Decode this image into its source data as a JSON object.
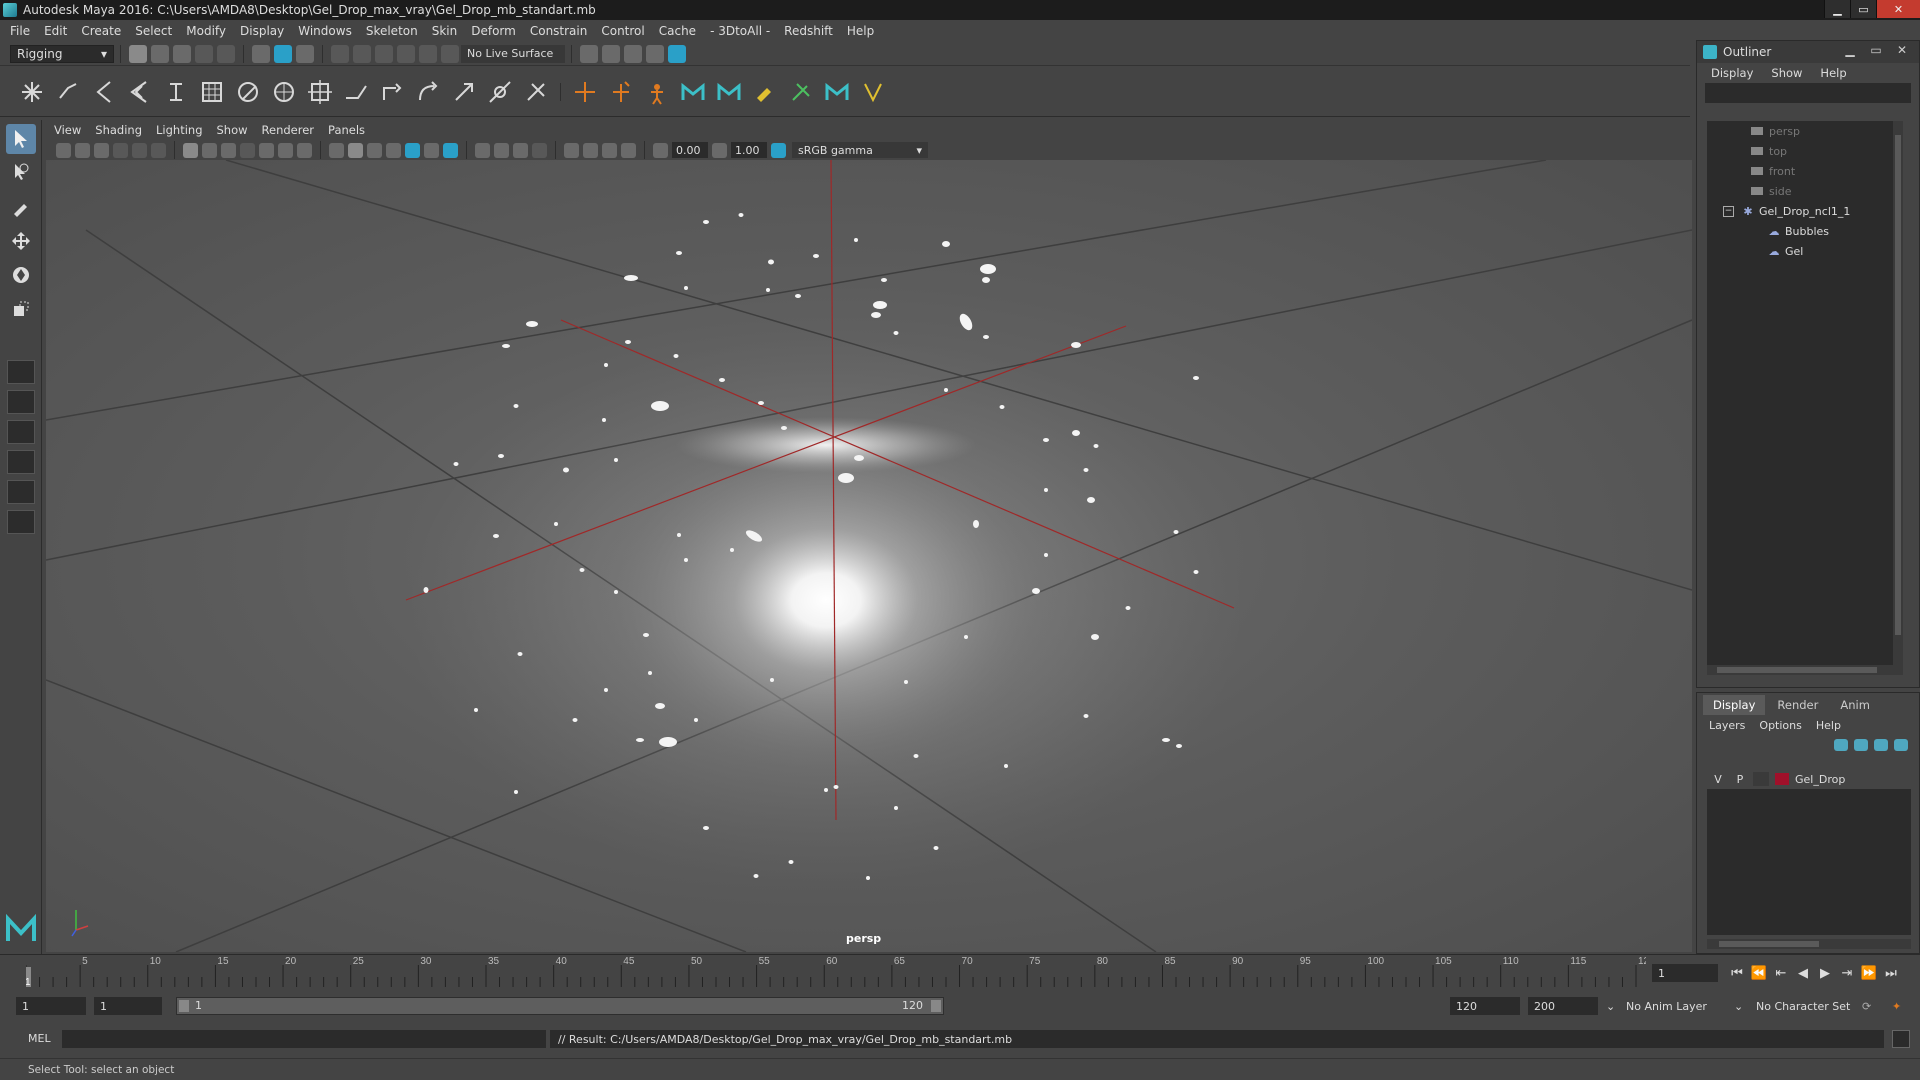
{
  "window": {
    "title": "Autodesk Maya 2016: C:\\Users\\AMDA8\\Desktop\\Gel_Drop_max_vray\\Gel_Drop_mb_standart.mb",
    "minimize": "▁",
    "maximize": "▭",
    "close": "✕"
  },
  "menubar": [
    "File",
    "Edit",
    "Create",
    "Select",
    "Modify",
    "Display",
    "Windows",
    "Skeleton",
    "Skin",
    "Deform",
    "Constrain",
    "Control",
    "Cache",
    "- 3DtoAll -",
    "Redshift",
    "Help"
  ],
  "statusline": {
    "mode": "Rigging",
    "live_surface": "No Live Surface"
  },
  "viewport": {
    "menu": [
      "View",
      "Shading",
      "Lighting",
      "Show",
      "Renderer",
      "Panels"
    ],
    "exposure": "0.00",
    "gamma": "1.00",
    "color_space": "sRGB gamma",
    "camera_label": "persp"
  },
  "outliner": {
    "title": "Outliner",
    "menu": [
      "Display",
      "Show",
      "Help"
    ],
    "cameras": [
      "persp",
      "top",
      "front",
      "side"
    ],
    "group": "Gel_Drop_ncl1_1",
    "children": [
      "Bubbles",
      "Gel"
    ]
  },
  "layer_editor": {
    "tabs": [
      "Display",
      "Render",
      "Anim"
    ],
    "active_tab": "Display",
    "menu": [
      "Layers",
      "Options",
      "Help"
    ],
    "layers": [
      {
        "visible": "V",
        "playback": "P",
        "name": "Gel_Drop",
        "color": "#a0102a"
      }
    ]
  },
  "timeslider": {
    "start": 1,
    "end": 120,
    "major_tick_step": 5,
    "current_frame": "1"
  },
  "playback": [
    "⏮",
    "⏪",
    "⇤",
    "◀",
    "▶",
    "⇥",
    "⏩",
    "⏭"
  ],
  "rangeslider": {
    "start_field": "1",
    "playback_start": "1",
    "range_start": "1",
    "range_end": "120",
    "playback_end": "120",
    "anim_end": "200",
    "anim_layer": "No Anim Layer",
    "character_set": "No Character Set"
  },
  "cmdline": {
    "label": "MEL",
    "result": "// Result: C:/Users/AMDA8/Desktop/Gel_Drop_max_vray/Gel_Drop_mb_standart.mb"
  },
  "helpline": "Select Tool: select an object"
}
